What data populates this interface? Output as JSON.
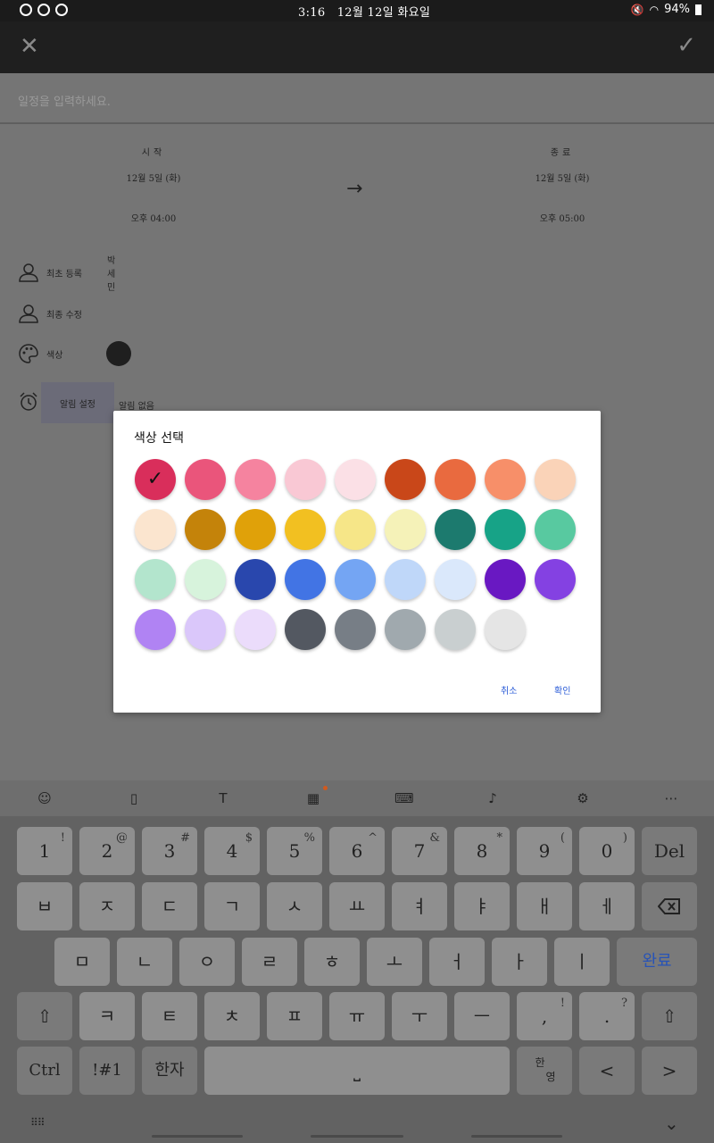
{
  "status_bar": {
    "time": "3:16",
    "date": "12월 12일 화요일",
    "battery": "94%"
  },
  "app_bar": {
    "close_icon": "close-icon",
    "confirm_icon": "check-icon"
  },
  "title": {
    "placeholder": "일정을 입력하세요."
  },
  "start": {
    "label": "시작",
    "date": "12월 5일 (화)",
    "time": "오후 04:00"
  },
  "end": {
    "label": "종료",
    "date": "12월 5일 (화)",
    "time": "오후 05:00"
  },
  "details": {
    "created_label": "최초 등록",
    "created_value": "박세민",
    "modified_label": "최종 수정",
    "color_label": "색상",
    "color_value": "#1f1f1f",
    "alarm_button": "알림 설정",
    "alarm_value": "알림 없음"
  },
  "color_dialog": {
    "title": "색상 선택",
    "selected_index": 0,
    "colors": [
      "#d92e5b",
      "#ea557b",
      "#f5839f",
      "#f9c8d4",
      "#fbe0e6",
      "#c94719",
      "#e96a3f",
      "#f78f69",
      "#fad3b8",
      "#fbe5cf",
      "#c4830a",
      "#e0a109",
      "#f2c021",
      "#f6e688",
      "#f5f2b8",
      "#1c7a6e",
      "#17a387",
      "#58c9a0",
      "#b3e5cd",
      "#d7f3dc",
      "#2947ad",
      "#4274e4",
      "#74a5f3",
      "#bfd7f9",
      "#dae8fb",
      "#6918c2",
      "#8441e2",
      "#b083f3",
      "#dac7fa",
      "#ebdcfb",
      "#535861",
      "#777e86",
      "#a0a9ae",
      "#c9cfd0",
      "#e5e5e5"
    ],
    "cancel": "취소",
    "ok": "확인"
  },
  "keyboard": {
    "row1": [
      [
        "1",
        "!"
      ],
      [
        "2",
        "@"
      ],
      [
        "3",
        "#"
      ],
      [
        "4",
        "$"
      ],
      [
        "5",
        "%"
      ],
      [
        "6",
        "^"
      ],
      [
        "7",
        "&"
      ],
      [
        "8",
        "*"
      ],
      [
        "9",
        "("
      ],
      [
        "0",
        ")"
      ]
    ],
    "del": "Del",
    "row2": [
      "ㅂ",
      "ㅈ",
      "ㄷ",
      "ㄱ",
      "ㅅ",
      "ㅛ",
      "ㅕ",
      "ㅑ",
      "ㅐ",
      "ㅔ"
    ],
    "row3": [
      "ㅁ",
      "ㄴ",
      "ㅇ",
      "ㄹ",
      "ㅎ",
      "ㅗ",
      "ㅓ",
      "ㅏ",
      "ㅣ"
    ],
    "done": "완료",
    "row4": [
      "ㅋ",
      "ㅌ",
      "ㅊ",
      "ㅍ",
      "ㅠ",
      "ㅜ",
      "ㅡ"
    ],
    "comma": ",",
    "comma_sub": "!",
    "period": ".",
    "period_sub": "?",
    "ctrl": "Ctrl",
    "symbols": "!#1",
    "hanja": "한자",
    "lang_top": "한",
    "lang_bottom": "영",
    "left": "<",
    "right": ">"
  }
}
